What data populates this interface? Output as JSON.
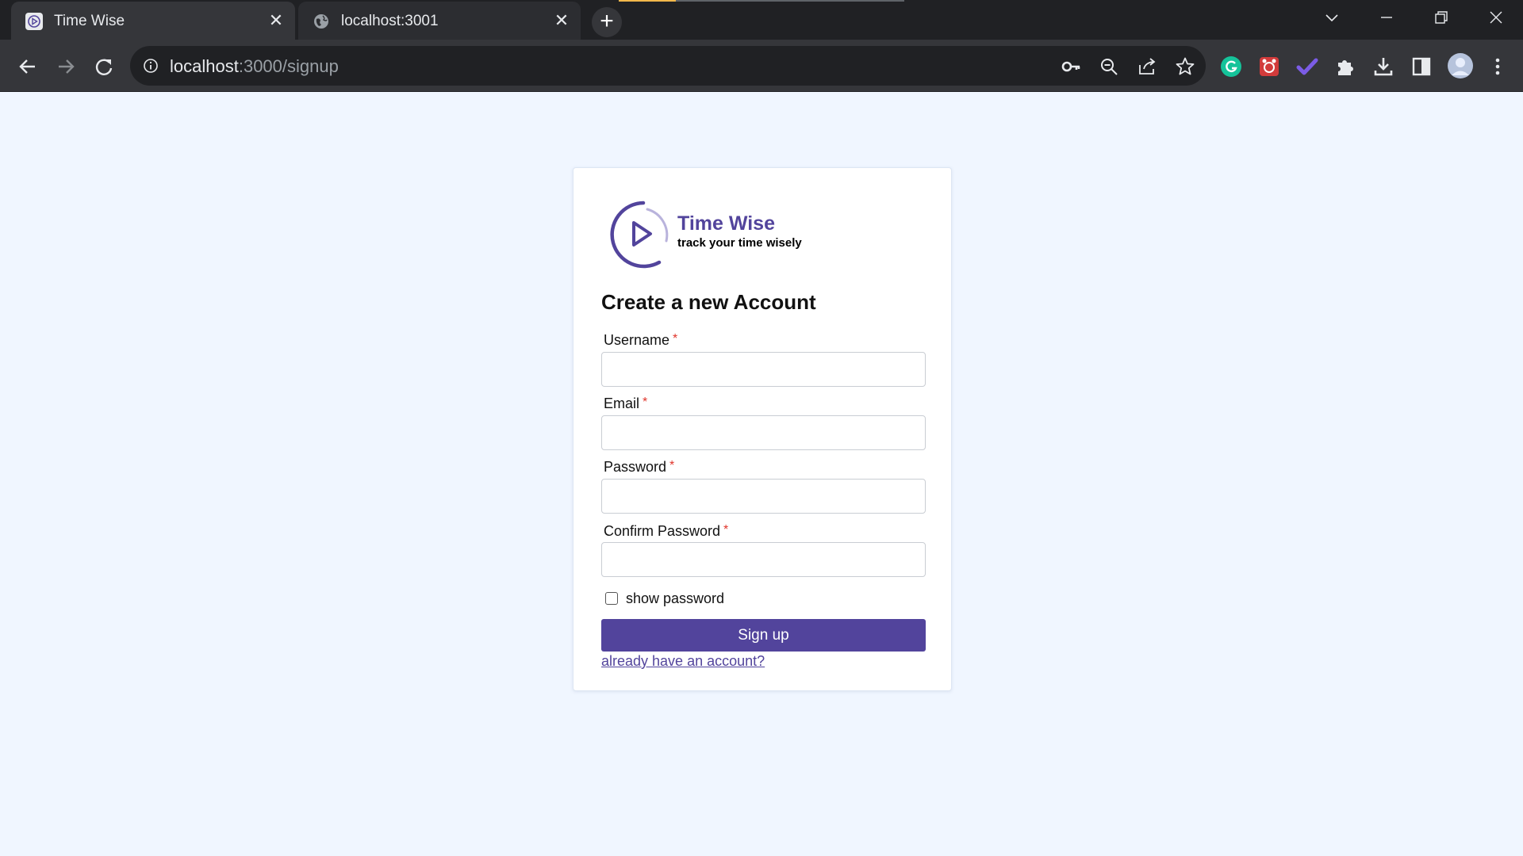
{
  "browser": {
    "tabs": [
      {
        "title": "Time Wise",
        "icon": "play-circle-favicon",
        "active": true
      },
      {
        "title": "localhost:3001",
        "icon": "globe-icon",
        "active": false
      }
    ],
    "address": {
      "host": "localhost",
      "path": ":3000/signup"
    },
    "colors": {
      "tabbar": "#202124",
      "toolbar": "#35363a",
      "loading": "#f2b84b"
    }
  },
  "brand": {
    "name": "Time Wise",
    "tagline": "track your time wisely",
    "color": "#52449c"
  },
  "form": {
    "heading": "Create a new Account",
    "required_marker": "*",
    "fields": [
      {
        "label": "Username",
        "value": ""
      },
      {
        "label": "Email",
        "value": ""
      },
      {
        "label": "Password",
        "value": ""
      },
      {
        "label": "Confirm Password",
        "value": ""
      }
    ],
    "show_password": {
      "label": "show password",
      "checked": false
    },
    "submit_label": "Sign up",
    "signin_link": "already have an account?"
  }
}
